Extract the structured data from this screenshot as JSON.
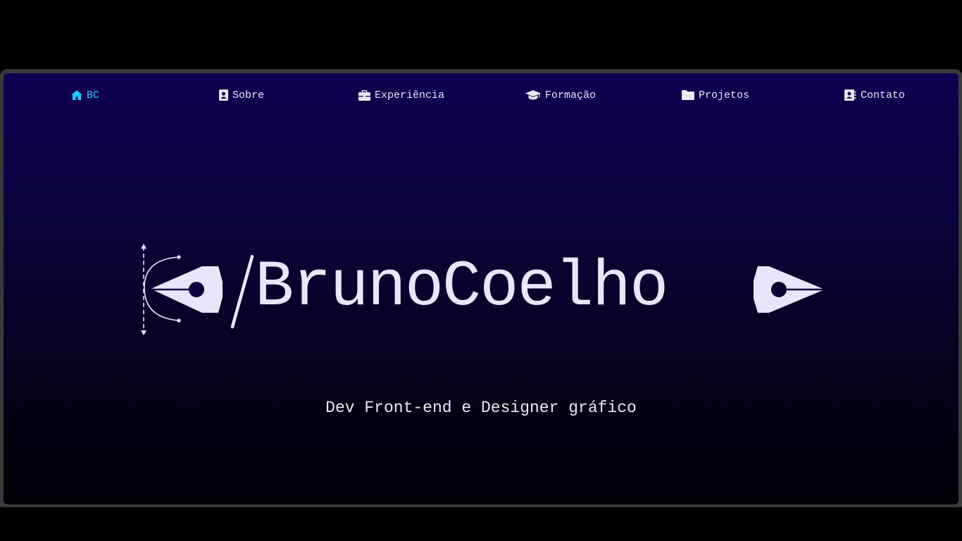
{
  "nav": {
    "items": [
      {
        "label": "BC",
        "icon": "home-icon",
        "active": true
      },
      {
        "label": "Sobre",
        "icon": "contact-card-icon",
        "active": false
      },
      {
        "label": "Experiência",
        "icon": "briefcase-icon",
        "active": false
      },
      {
        "label": "Formação",
        "icon": "graduation-cap-icon",
        "active": false
      },
      {
        "label": "Projetos",
        "icon": "folder-icon",
        "active": false
      },
      {
        "label": "Contato",
        "icon": "address-book-icon",
        "active": false
      }
    ]
  },
  "hero": {
    "logo_text": "BrunoCoelho",
    "tagline": "Dev Front-end e Designer gráfico"
  },
  "colors": {
    "accent": "#1ec8ff",
    "text": "#e9e6fb",
    "background_top": "#0e0050",
    "background_bottom": "#020108"
  }
}
